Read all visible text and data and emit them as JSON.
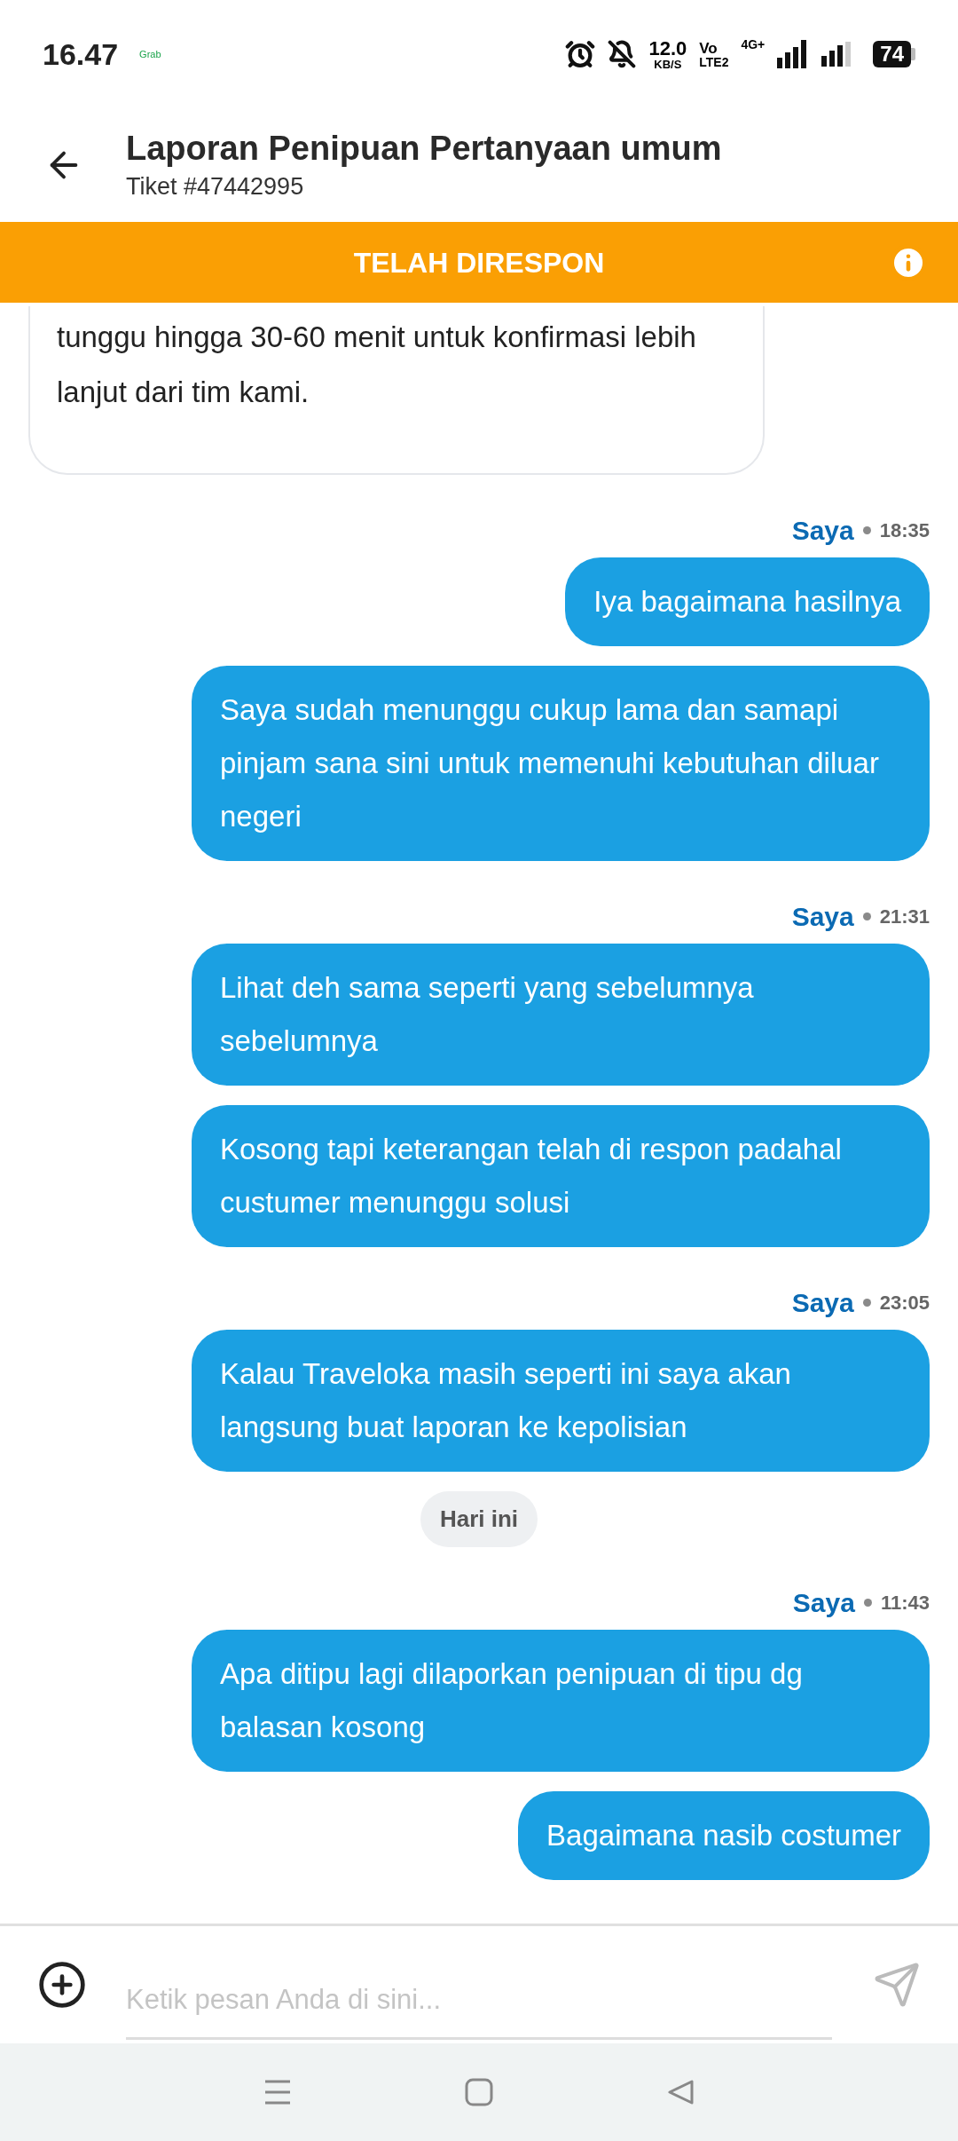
{
  "status_bar": {
    "time": "16.47",
    "notification": "Grab",
    "speed": "12.0",
    "speed_unit": "KB/S",
    "volte": "Vo",
    "volte_sub": "LTE2",
    "network": "4G+",
    "battery": "74"
  },
  "header": {
    "title": "Laporan Penipuan Pertanyaan umum",
    "subtitle": "Tiket #47442995"
  },
  "banner": {
    "label": "TELAH DIRESPON"
  },
  "messages": [
    {
      "kind": "agent",
      "text": "tunggu hingga 30-60 menit untuk konfirmasi lebih lanjut dari tim kami."
    },
    {
      "kind": "meta",
      "sender": "Saya",
      "time": "18:35"
    },
    {
      "kind": "bubble",
      "text": "Iya bagaimana hasilnya"
    },
    {
      "kind": "bubble",
      "text": "Saya sudah menunggu cukup lama dan samapi pinjam sana sini untuk memenuhi kebutuhan diluar negeri"
    },
    {
      "kind": "meta",
      "sender": "Saya",
      "time": "21:31"
    },
    {
      "kind": "bubble",
      "text": "Lihat deh sama seperti yang sebelumnya sebelumnya"
    },
    {
      "kind": "bubble",
      "text": "Kosong tapi keterangan telah di respon padahal custumer menunggu solusi"
    },
    {
      "kind": "meta",
      "sender": "Saya",
      "time": "23:05"
    },
    {
      "kind": "bubble",
      "text": "Kalau Traveloka masih seperti ini saya akan langsung buat laporan ke kepolisian"
    },
    {
      "kind": "date",
      "text": "Hari ini"
    },
    {
      "kind": "meta",
      "sender": "Saya",
      "time": "11:43"
    },
    {
      "kind": "bubble",
      "text": "Apa ditipu lagi dilaporkan penipuan di tipu dg balasan kosong"
    },
    {
      "kind": "bubble",
      "text": "Bagaimana nasib costumer"
    }
  ],
  "composer": {
    "placeholder": "Ketik pesan Anda di sini..."
  }
}
